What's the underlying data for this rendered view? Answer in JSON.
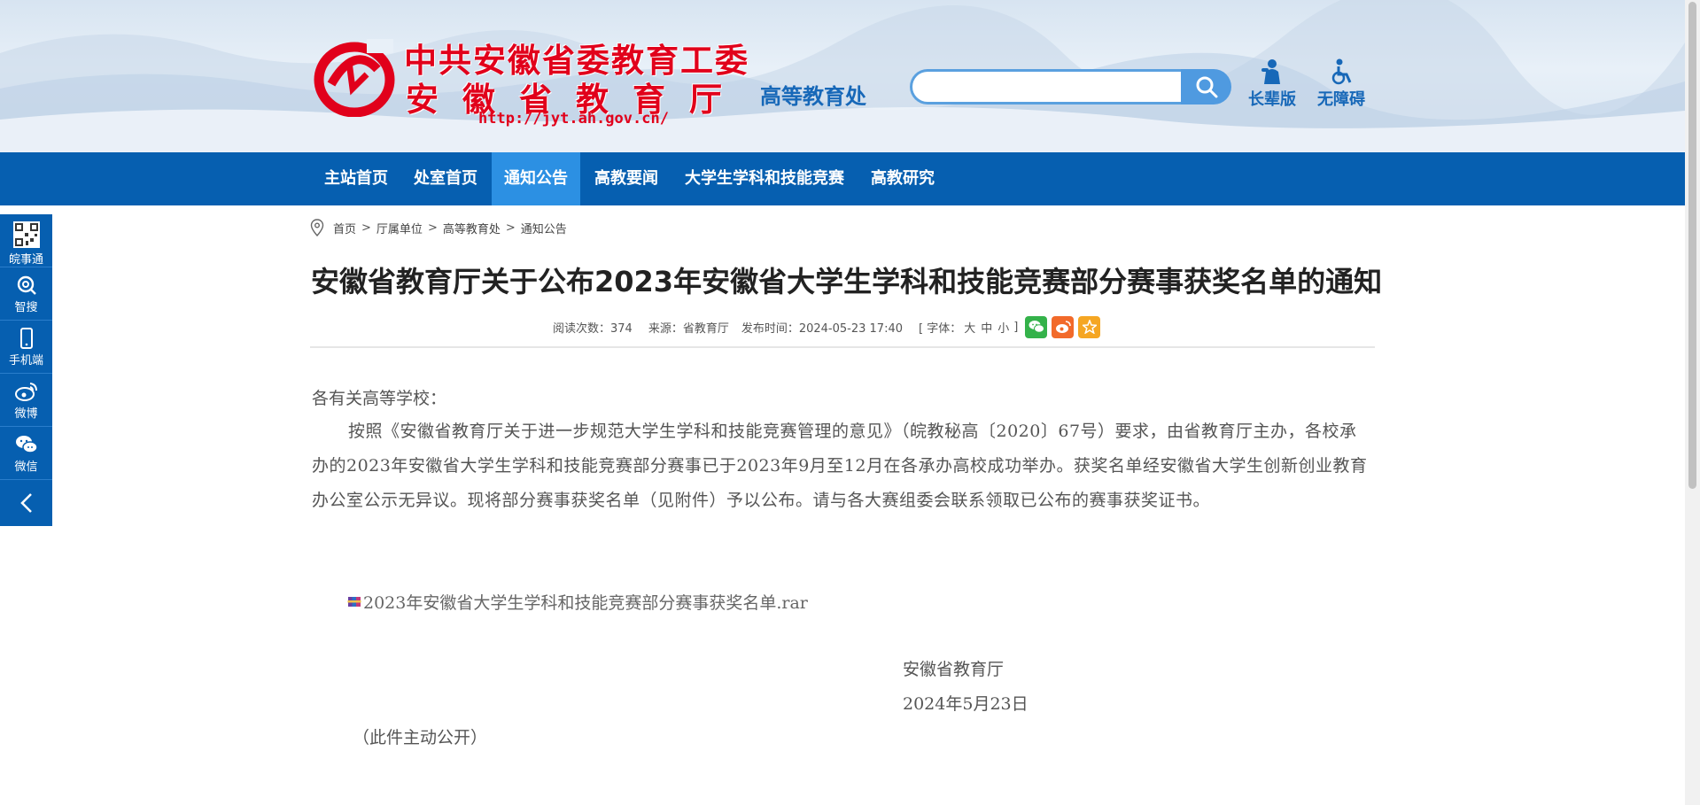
{
  "header": {
    "logo_line1": "中共安徽省委教育工委",
    "logo_line2": "安徽省教育厅",
    "logo_url": "http://jyt.ah.gov.cn/",
    "dept_name": "高等教育处",
    "search": {
      "placeholder": "",
      "value": ""
    },
    "tools": [
      {
        "label": "长辈版",
        "icon": "elder-icon"
      },
      {
        "label": "无障碍",
        "icon": "accessibility-icon"
      }
    ],
    "colors": {
      "brand_red": "#e1001b",
      "brand_blue": "#1768b8"
    }
  },
  "nav": {
    "items": [
      {
        "label": "主站首页"
      },
      {
        "label": "处室首页"
      },
      {
        "label": "通知公告",
        "active": true
      },
      {
        "label": "高教要闻"
      },
      {
        "label": "大学生学科和技能竞赛"
      },
      {
        "label": "高教研究"
      }
    ],
    "colors": {
      "bar": "#065fb0",
      "active": "#2c90e3"
    }
  },
  "floatbar": {
    "items": [
      {
        "label": "皖事通",
        "icon": "qrcode-icon"
      },
      {
        "label": "智搜",
        "icon": "smart-search-icon"
      },
      {
        "label": "手机端",
        "icon": "mobile-icon"
      },
      {
        "label": "微博",
        "icon": "weibo-icon"
      },
      {
        "label": "微信",
        "icon": "wechat-icon"
      }
    ],
    "collapse_icon": "chevron-left-icon"
  },
  "breadcrumb": {
    "items": [
      "首页",
      "厅属单位",
      "高等教育处",
      "通知公告"
    ],
    "separator": ">"
  },
  "article": {
    "title": "安徽省教育厅关于公布2023年安徽省大学生学科和技能竞赛部分赛事获奖名单的通知",
    "meta": {
      "views": "阅读次数：374",
      "source": "来源：省教育厅",
      "published": "发布时间：2024-05-23 17:40",
      "font_label_open": "[ 字体：",
      "font_large": "大",
      "font_medium": "中",
      "font_small": "小",
      "font_label_close": "]"
    },
    "share": [
      {
        "icon": "wechat-share-icon",
        "color": "#34b24a"
      },
      {
        "icon": "weibo-share-icon",
        "color": "#f26a2a"
      },
      {
        "icon": "favorite-star-icon",
        "color": "#f5a623"
      }
    ],
    "salutation": "各有关高等学校：",
    "paragraph": "按照《安徽省教育厅关于进一步规范大学生学科和技能竞赛管理的意见》（皖教秘高〔2020〕67号）要求，由省教育厅主办，各校承办的2023年安徽省大学生学科和技能竞赛部分赛事已于2023年9月至12月在各承办高校成功举办。获奖名单经安徽省大学生创新创业教育办公室公示无异议。现将部分赛事获奖名单（见附件）予以公布。请与各大赛组委会联系领取已公布的赛事获奖证书。",
    "attachment": "2023年安徽省大学生学科和技能竞赛部分赛事获奖名单.rar",
    "sign_org": "安徽省教育厅",
    "sign_date": "2024年5月23日",
    "public_note": "（此件主动公开）"
  }
}
